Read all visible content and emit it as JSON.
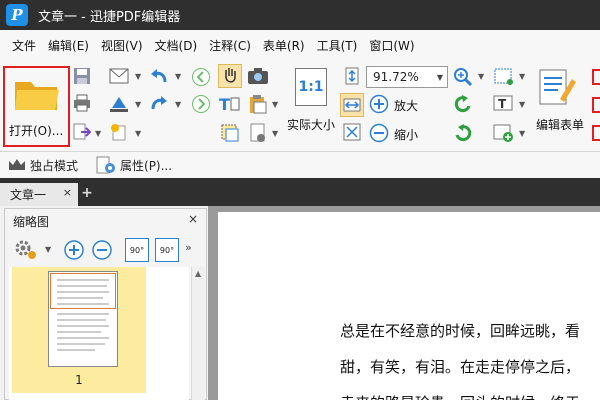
{
  "window": {
    "title": "文章一 - 迅捷PDF编辑器",
    "logo_glyph": "P",
    "logo_color": "#1e90e6"
  },
  "menu": [
    "文件",
    "编辑(E)",
    "视图(V)",
    "文档(D)",
    "注释(C)",
    "表单(R)",
    "工具(T)",
    "窗口(W)"
  ],
  "ribbon": {
    "open_label": "打开(O)...",
    "zoom_value": "91.72%",
    "zoom_in_label": "放大",
    "zoom_out_label": "缩小",
    "actual_size_label": "实际大小",
    "actual_size_icon_text": "1:1",
    "edit_form_label": "编辑表单",
    "icons": [
      "folder-icon",
      "save-icon",
      "print-icon",
      "email-icon",
      "undo-icon",
      "redo-icon",
      "back-icon",
      "forward-icon",
      "hand-icon",
      "camera-icon",
      "text-select-icon",
      "clipboard-icon",
      "fit-page-icon",
      "fit-width-icon",
      "zoom-in-icon",
      "zoom-out-icon",
      "rotate-left-icon",
      "rotate-right-icon",
      "snapshot-select-icon",
      "text-tool-icon",
      "edit-form-icon",
      "highlight-icon"
    ]
  },
  "subbar": {
    "exclusive_mode_label": "独占模式",
    "properties_label": "属性(P)..."
  },
  "tabs": {
    "active_tab_label": "文章一",
    "close_glyph": "×",
    "add_glyph": "+"
  },
  "thumbnail_panel": {
    "title": "缩略图",
    "close_glyph": "×",
    "rotate_left_text": "90°",
    "rotate_right_text": "90°",
    "page_number": "1",
    "selected_color": "#fdeba0"
  },
  "document": {
    "lines": [
      "总是在不经意的时候，回眸远眺，看",
      "甜，有笑，有泪。在走走停停之后，",
      "走来的路是珍贵，回头的时候，终于"
    ]
  },
  "colors": {
    "titlebar": "#2f2f2f",
    "accent_red": "#e02020",
    "icon_blue": "#2b7fd4",
    "icon_green": "#2e9e3e"
  }
}
